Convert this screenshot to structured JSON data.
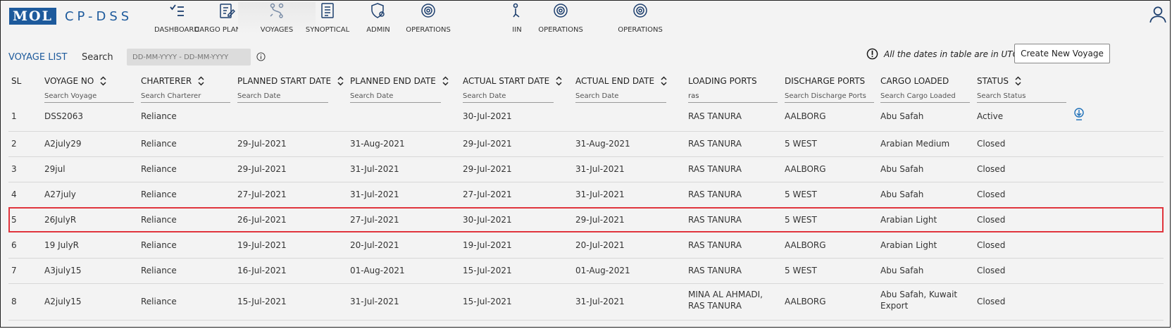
{
  "brand": {
    "logo": "MOL",
    "name": "CP-DSS"
  },
  "nav": [
    {
      "label": "DASHBOARD",
      "icon": "checklist-icon"
    },
    {
      "label": "CARGO PLANNING",
      "icon": "clipboard-edit-icon"
    },
    {
      "label": "VOYAGES",
      "icon": "route-icon"
    },
    {
      "label": "SYNOPTICAL",
      "icon": "document-list-icon"
    },
    {
      "label": "ADMIN",
      "icon": "admin-shield-icon"
    },
    {
      "label": "OPERATIONS",
      "icon": "gear-icon"
    },
    {
      "label": "IIN",
      "icon": "person-icon"
    },
    {
      "label": "OPERATIONS",
      "icon": "gear-icon"
    },
    {
      "label": "OPERATIONS",
      "icon": "gear-icon"
    }
  ],
  "toolbar": {
    "voyage_list": "VOYAGE LIST",
    "search_label": "Search",
    "date_placeholder": "DD-MM-YYYY - DD-MM-YYYY",
    "utc_note": "All the dates in table are in UTC",
    "create_button": "Create New Voyage"
  },
  "columns": [
    {
      "label": "SL",
      "sortable": false,
      "search": null
    },
    {
      "label": "VOYAGE NO",
      "sortable": true,
      "search": {
        "placeholder": "Search Voyage",
        "value": ""
      }
    },
    {
      "label": "CHARTERER",
      "sortable": true,
      "search": {
        "placeholder": "Search Charterer",
        "value": ""
      }
    },
    {
      "label": "PLANNED START DATE",
      "sortable": true,
      "search": {
        "placeholder": "Search Date",
        "value": ""
      }
    },
    {
      "label": "PLANNED END DATE",
      "sortable": true,
      "search": {
        "placeholder": "Search Date",
        "value": ""
      }
    },
    {
      "label": "ACTUAL START DATE",
      "sortable": true,
      "search": {
        "placeholder": "Search Date",
        "value": ""
      }
    },
    {
      "label": "ACTUAL END DATE",
      "sortable": true,
      "search": {
        "placeholder": "Search Date",
        "value": ""
      }
    },
    {
      "label": "LOADING PORTS",
      "sortable": false,
      "search": {
        "placeholder": "",
        "value": "ras"
      }
    },
    {
      "label": "DISCHARGE PORTS",
      "sortable": false,
      "search": {
        "placeholder": "Search Discharge Ports",
        "value": ""
      }
    },
    {
      "label": "CARGO LOADED",
      "sortable": false,
      "search": {
        "placeholder": "Search Cargo Loaded",
        "value": ""
      }
    },
    {
      "label": "STATUS",
      "sortable": true,
      "search": {
        "placeholder": "Search Status",
        "value": ""
      }
    }
  ],
  "rows": [
    {
      "sl": "1",
      "voyage": "DSS2063",
      "charterer": "Reliance",
      "planned_start": "",
      "planned_end": "",
      "actual_start": "30-Jul-2021",
      "actual_end": "",
      "loading": [
        "RAS TANURA"
      ],
      "discharge": "AALBORG",
      "cargo": [
        "Abu Safah"
      ],
      "status": "Active",
      "download": true
    },
    {
      "sl": "2",
      "voyage": "A2july29",
      "charterer": "Reliance",
      "planned_start": "29-Jul-2021",
      "planned_end": "31-Aug-2021",
      "actual_start": "29-Jul-2021",
      "actual_end": "31-Aug-2021",
      "loading": [
        "RAS TANURA"
      ],
      "discharge": "5 WEST",
      "cargo": [
        "Arabian Medium"
      ],
      "status": "Closed"
    },
    {
      "sl": "3",
      "voyage": "29jul",
      "charterer": "Reliance",
      "planned_start": "29-Jul-2021",
      "planned_end": "31-Jul-2021",
      "actual_start": "29-Jul-2021",
      "actual_end": "31-Jul-2021",
      "loading": [
        "RAS TANURA"
      ],
      "discharge": "AALBORG",
      "cargo": [
        "Abu Safah"
      ],
      "status": "Closed"
    },
    {
      "sl": "4",
      "voyage": "A27july",
      "charterer": "Reliance",
      "planned_start": "27-Jul-2021",
      "planned_end": "31-Jul-2021",
      "actual_start": "27-Jul-2021",
      "actual_end": "31-Jul-2021",
      "loading": [
        "RAS TANURA"
      ],
      "discharge": "5 WEST",
      "cargo": [
        "Abu Safah"
      ],
      "status": "Closed"
    },
    {
      "sl": "5",
      "voyage": "26JulyR",
      "charterer": "Reliance",
      "planned_start": "26-Jul-2021",
      "planned_end": "27-Jul-2021",
      "actual_start": "30-Jul-2021",
      "actual_end": "29-Jul-2021",
      "loading": [
        "RAS TANURA"
      ],
      "discharge": "5 WEST",
      "cargo": [
        "Arabian Light"
      ],
      "status": "Closed",
      "selected": true
    },
    {
      "sl": "6",
      "voyage": "19 JulyR",
      "charterer": "Reliance",
      "planned_start": "19-Jul-2021",
      "planned_end": "20-Jul-2021",
      "actual_start": "19-Jul-2021",
      "actual_end": "20-Jul-2021",
      "loading": [
        "RAS TANURA"
      ],
      "discharge": "AALBORG",
      "cargo": [
        "Arabian Light"
      ],
      "status": "Closed"
    },
    {
      "sl": "7",
      "voyage": "A3july15",
      "charterer": "Reliance",
      "planned_start": "16-Jul-2021",
      "planned_end": "01-Aug-2021",
      "actual_start": "15-Jul-2021",
      "actual_end": "01-Aug-2021",
      "loading": [
        "RAS TANURA"
      ],
      "discharge": "5 WEST",
      "cargo": [
        "Abu Safah"
      ],
      "status": "Closed"
    },
    {
      "sl": "8",
      "voyage": "A2july15",
      "charterer": "Reliance",
      "planned_start": "15-Jul-2021",
      "planned_end": "31-Jul-2021",
      "actual_start": "15-Jul-2021",
      "actual_end": "31-Jul-2021",
      "loading": [
        "MINA AL AHMADI,",
        "RAS TANURA"
      ],
      "discharge": "AALBORG",
      "cargo": [
        "Abu Safah, Kuwait",
        "Export"
      ],
      "status": "Closed"
    }
  ],
  "colors": {
    "brand": "#1d5a9c",
    "selected_outline": "#e0353d",
    "accent": "#1d6fb8"
  }
}
